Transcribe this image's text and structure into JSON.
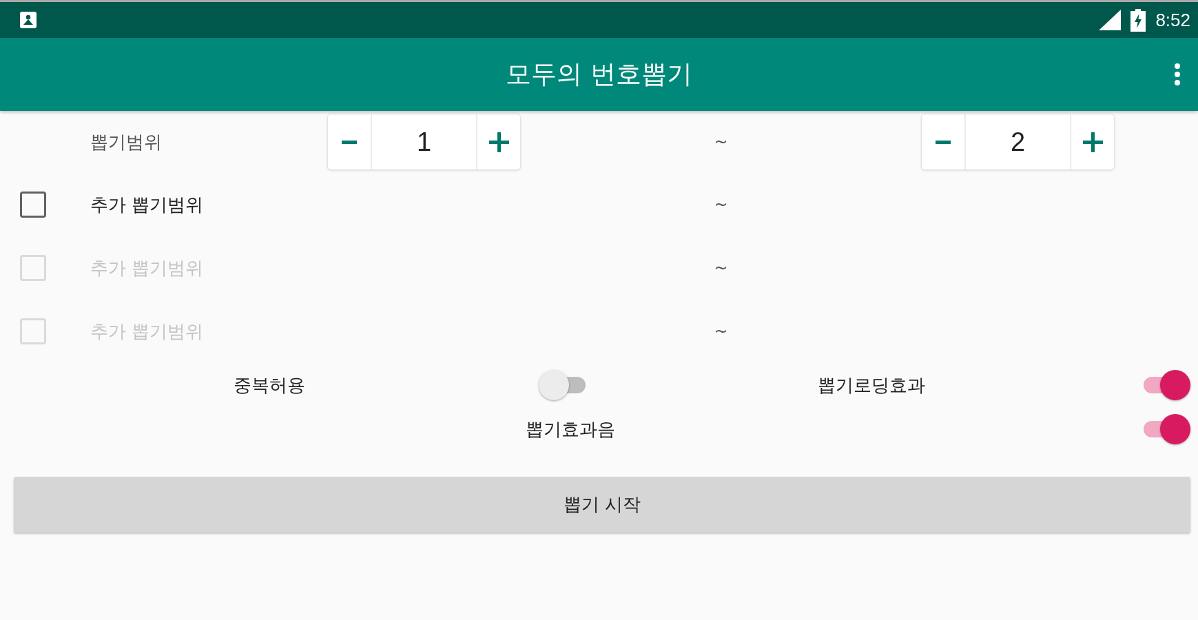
{
  "status_bar": {
    "time": "8:52"
  },
  "app_bar": {
    "title": "모두의 번호뽑기"
  },
  "range": {
    "label": "뽑기범위",
    "from": {
      "value": "1"
    },
    "separator": "~",
    "to": {
      "value": "2"
    }
  },
  "extra_ranges": [
    {
      "label": "추가 뽑기범위",
      "checked": false,
      "disabled": false,
      "separator": "~"
    },
    {
      "label": "추가 뽑기범위",
      "checked": false,
      "disabled": true,
      "separator": "~"
    },
    {
      "label": "추가 뽑기범위",
      "checked": false,
      "disabled": true,
      "separator": "~"
    }
  ],
  "switch_rows": [
    {
      "switches": [
        {
          "label": "중복허용",
          "on": false
        },
        {
          "label": "뽑기로딩효과",
          "on": true
        }
      ]
    },
    {
      "switches": [
        {
          "label": "뽑기효과음",
          "on": true
        }
      ]
    }
  ],
  "start_button": {
    "label": "뽑기 시작"
  }
}
